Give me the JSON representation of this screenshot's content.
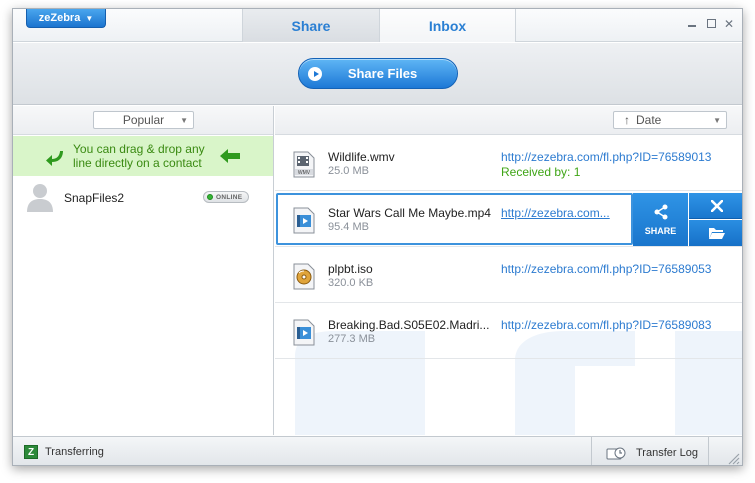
{
  "app": {
    "brand_label": "zeZebra",
    "tabs": [
      {
        "label": "Share",
        "active": true
      },
      {
        "label": "Inbox",
        "active": false
      }
    ]
  },
  "toolbar": {
    "share_files_label": "Share Files"
  },
  "left_pane": {
    "sort_label": "Popular",
    "hint": "You can drag & drop any line directly on a contact",
    "contacts": [
      {
        "name": "SnapFiles2",
        "status": "ONLINE"
      }
    ]
  },
  "right_pane": {
    "sort_label": "Date",
    "files": [
      {
        "name": "Wildlife.wmv",
        "size": "25.0 MB",
        "link": "http://zezebra.com/fl.php?ID=76589013",
        "received": "Received by: 1",
        "icon": "wmv-file-icon"
      },
      {
        "name": "Star Wars Call Me Maybe.mp4",
        "size": "95.4 MB",
        "link": "http://zezebra.com...",
        "received": "",
        "icon": "video-file-icon",
        "selected": true
      },
      {
        "name": "plpbt.iso",
        "size": "320.0 KB",
        "link": "http://zezebra.com/fl.php?ID=76589053",
        "received": "",
        "icon": "iso-file-icon"
      },
      {
        "name": "Breaking.Bad.S05E02.Madri...",
        "size": "277.3 MB",
        "link": "http://zezebra.com/fl.php?ID=76589083",
        "received": "",
        "icon": "video-file-icon"
      }
    ],
    "share_action_label": "SHARE"
  },
  "statusbar": {
    "status_text": "Transferring",
    "transfer_log_label": "Transfer Log"
  },
  "colors": {
    "accent": "#1d78d6",
    "hint_bg": "#d9f5c9",
    "hint_text": "#3a8a12",
    "link": "#2c7bd0",
    "received": "#3fa516"
  }
}
